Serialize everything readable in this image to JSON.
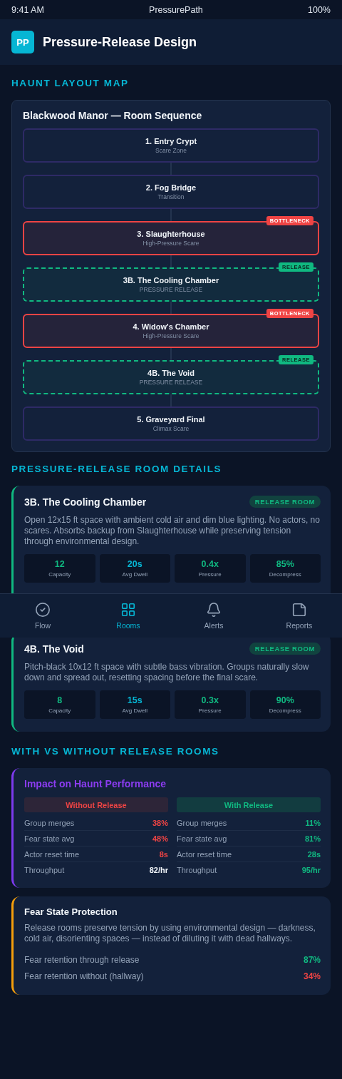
{
  "status_bar": {
    "time": "9:41 AM",
    "title": "PressurePath",
    "battery": "100%"
  },
  "header": {
    "logo": "PP",
    "title": "Pressure-Release Design"
  },
  "layout_map": {
    "heading": "HAUNT LAYOUT MAP",
    "title": "Blackwood Manor — Room Sequence",
    "rooms": [
      {
        "name": "1. Entry Crypt",
        "subtitle": "Scare Zone",
        "kind": "standard"
      },
      {
        "name": "2. Fog Bridge",
        "subtitle": "Transition",
        "kind": "standard"
      },
      {
        "name": "3. Slaughterhouse",
        "subtitle": "High-Pressure Scare",
        "kind": "bottleneck",
        "badge": "BOTTLENECK"
      },
      {
        "name": "3B. The Cooling Chamber",
        "subtitle": "PRESSURE RELEASE",
        "kind": "release",
        "badge": "RELEASE"
      },
      {
        "name": "4. Widow's Chamber",
        "subtitle": "High-Pressure Scare",
        "kind": "bottleneck",
        "badge": "BOTTLENECK"
      },
      {
        "name": "4B. The Void",
        "subtitle": "PRESSURE RELEASE",
        "kind": "release",
        "badge": "RELEASE"
      },
      {
        "name": "5. Graveyard Final",
        "subtitle": "Climax Scare",
        "kind": "standard"
      }
    ]
  },
  "details": {
    "heading": "PRESSURE-RELEASE ROOM DETAILS",
    "rooms": [
      {
        "name": "3B. The Cooling Chamber",
        "badge": "RELEASE ROOM",
        "description": "Open 12x15 ft space with ambient cold air and dim blue lighting. No actors, no scares. Absorbs backup from Slaughterhouse while preserving tension through environmental design.",
        "stats": [
          {
            "value": "12",
            "label": "Capacity",
            "color": "#10b981"
          },
          {
            "value": "20s",
            "label": "Avg Dwell",
            "color": "#06b6d4"
          },
          {
            "value": "0.4x",
            "label": "Pressure",
            "color": "#10b981"
          },
          {
            "value": "85%",
            "label": "Decompress",
            "color": "#10b981"
          }
        ]
      },
      {
        "name": "4B. The Void",
        "badge": "RELEASE ROOM",
        "description": "Pitch-black 10x12 ft space with subtle bass vibration. Groups naturally slow down and spread out, resetting spacing before the final scare.",
        "stats": [
          {
            "value": "8",
            "label": "Capacity",
            "color": "#10b981"
          },
          {
            "value": "15s",
            "label": "Avg Dwell",
            "color": "#06b6d4"
          },
          {
            "value": "0.3x",
            "label": "Pressure",
            "color": "#10b981"
          },
          {
            "value": "90%",
            "label": "Decompress",
            "color": "#10b981"
          }
        ]
      }
    ]
  },
  "comparison": {
    "heading": "WITH VS WITHOUT RELEASE ROOMS",
    "title": "Impact on Haunt Performance",
    "columns": [
      {
        "heading": "Without Release",
        "kind": "without",
        "rows": [
          {
            "label": "Group merges",
            "value": "38%",
            "color": "#ef4444"
          },
          {
            "label": "Fear state avg",
            "value": "48%",
            "color": "#ef4444"
          },
          {
            "label": "Actor reset time",
            "value": "8s",
            "color": "#ef4444"
          },
          {
            "label": "Throughput",
            "value": "82/hr",
            "color": "#f1f5f9"
          }
        ]
      },
      {
        "heading": "With Release",
        "kind": "with",
        "rows": [
          {
            "label": "Group merges",
            "value": "11%",
            "color": "#10b981"
          },
          {
            "label": "Fear state avg",
            "value": "81%",
            "color": "#10b981"
          },
          {
            "label": "Actor reset time",
            "value": "28s",
            "color": "#10b981"
          },
          {
            "label": "Throughput",
            "value": "95/hr",
            "color": "#10b981"
          }
        ]
      }
    ]
  },
  "protection": {
    "title": "Fear State Protection",
    "description": "Release rooms preserve tension by using environmental design — darkness, cold air, disorienting spaces — instead of diluting it with dead hallways.",
    "rows": [
      {
        "label": "Fear retention through release",
        "value": "87%",
        "color": "#10b981"
      },
      {
        "label": "Fear retention without (hallway)",
        "value": "34%",
        "color": "#ef4444"
      }
    ]
  },
  "nav": [
    {
      "label": "Flow",
      "kind": "flow",
      "selected": false
    },
    {
      "label": "Rooms",
      "kind": "rooms",
      "selected": true
    },
    {
      "label": "Alerts",
      "kind": "alerts",
      "selected": false
    },
    {
      "label": "Reports",
      "kind": "reports",
      "selected": false
    }
  ]
}
